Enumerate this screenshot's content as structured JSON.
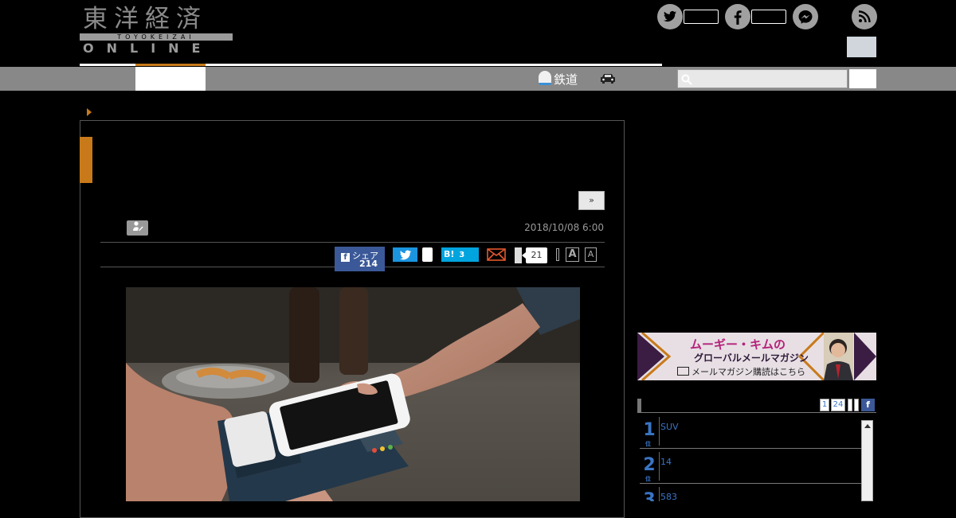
{
  "header": {
    "logo_kanji": "東洋経済",
    "logo_romaji": "TOYOKEIZAI",
    "logo_online": "ONLINE",
    "social_icons": [
      "twitter-icon",
      "facebook-icon",
      "messenger-icon",
      "rss-icon"
    ]
  },
  "nav": {
    "rail_label": "鉄道",
    "car_icon": "car-icon",
    "search": {
      "placeholder": "",
      "value": ""
    }
  },
  "article": {
    "next_label": "»",
    "date": "2018/10/08 6:00",
    "share": {
      "facebook_label": "シェア",
      "facebook_count": "214",
      "hatena_label": "B!",
      "hatena_count": "3",
      "comment_count": "21"
    },
    "font_size": {
      "large": "A",
      "small": "A"
    },
    "photo_alt": "スマートフォンによるタッチ決済"
  },
  "sidebar": {
    "banner": {
      "title": "ムーギー・キムの",
      "subtitle": "グローバルメールマガジン",
      "cta": "メールマガジン購読はこちら"
    },
    "ranking": {
      "tabs": [
        "1",
        "24"
      ],
      "rank_unit": "位",
      "items": [
        {
          "rank": "1",
          "title": "SUV"
        },
        {
          "rank": "2",
          "title": "14"
        },
        {
          "rank": "3",
          "title": "583"
        }
      ]
    }
  },
  "colors": {
    "accent": "#c87a1a",
    "navbar": "#888888",
    "facebook": "#3b5998",
    "twitter": "#1b95e0",
    "hatena": "#00a4de",
    "rank_blue": "#3a75c4"
  }
}
